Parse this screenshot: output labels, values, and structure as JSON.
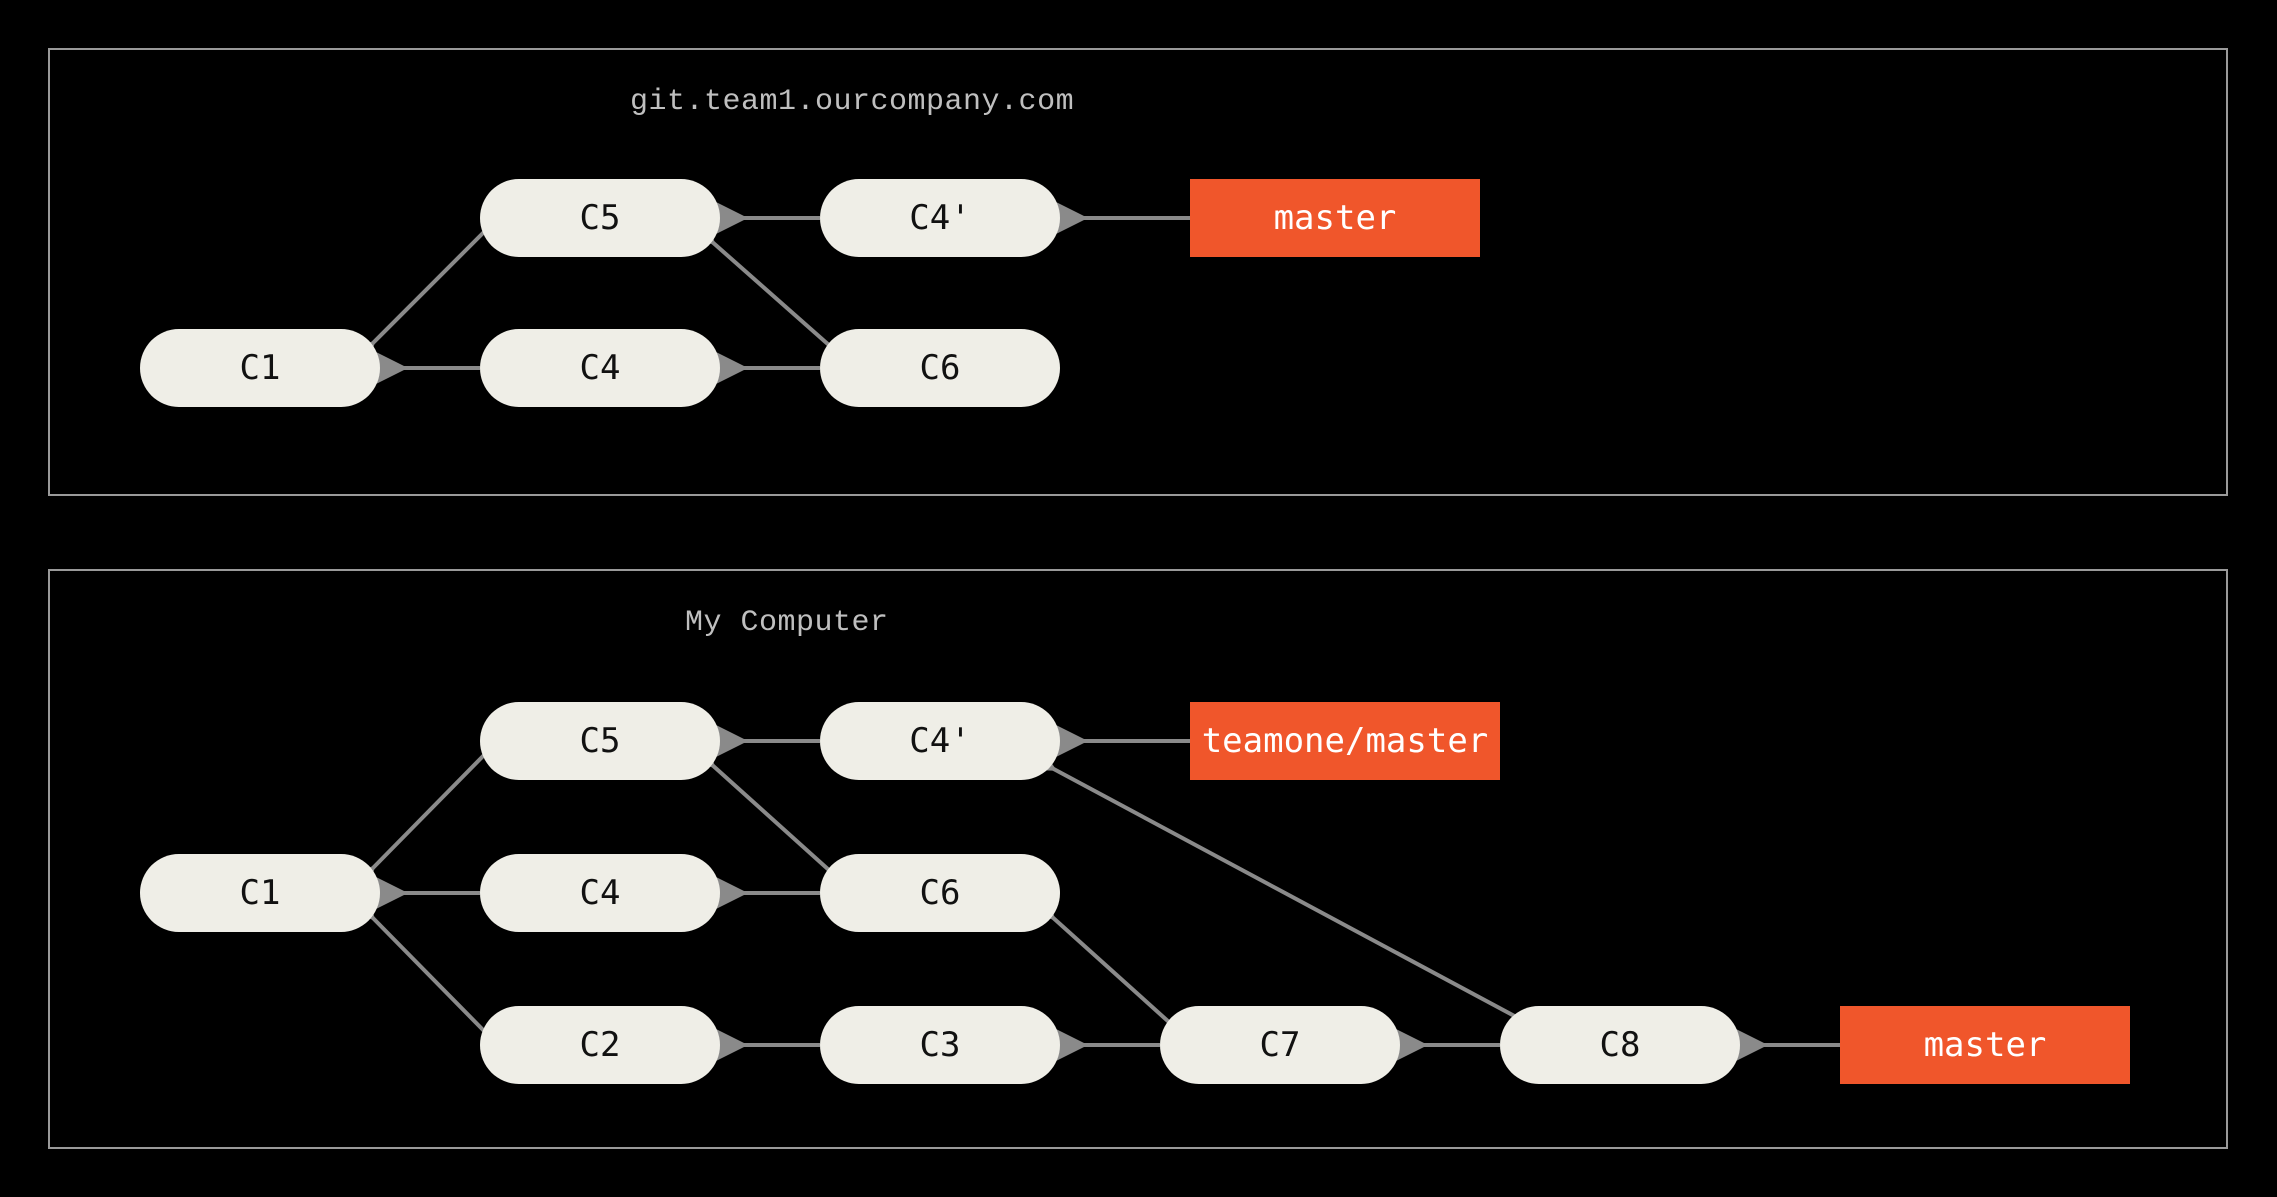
{
  "colors": {
    "bg": "#000000",
    "panel_border": "#9a9a9a",
    "commit_bg": "#efeee7",
    "commit_fg": "#111111",
    "ref_bg": "#f0562b",
    "ref_fg": "#ffffff",
    "arrow": "#8a8a8a",
    "title": "#bfbfbf"
  },
  "panels": {
    "server": {
      "title": "git.team1.ourcompany.com",
      "commits": {
        "c1": "C1",
        "c4": "C4",
        "c5": "C5",
        "c6": "C6",
        "c4p": "C4'"
      },
      "refs": {
        "master": "master"
      },
      "edges": [
        [
          "c5",
          "c1"
        ],
        [
          "c4",
          "c1"
        ],
        [
          "c6",
          "c4"
        ],
        [
          "c6",
          "c5"
        ],
        [
          "c4p",
          "c5"
        ],
        [
          "master",
          "c4p"
        ]
      ]
    },
    "local": {
      "title": "My Computer",
      "commits": {
        "c1": "C1",
        "c2": "C2",
        "c3": "C3",
        "c4": "C4",
        "c5": "C5",
        "c6": "C6",
        "c7": "C7",
        "c8": "C8",
        "c4p": "C4'"
      },
      "refs": {
        "teamone_master": "teamone/master",
        "master": "master"
      },
      "edges": [
        [
          "c5",
          "c1"
        ],
        [
          "c4",
          "c1"
        ],
        [
          "c2",
          "c1"
        ],
        [
          "c6",
          "c4"
        ],
        [
          "c3",
          "c2"
        ],
        [
          "c6",
          "c5"
        ],
        [
          "c4p",
          "c5"
        ],
        [
          "c7",
          "c3"
        ],
        [
          "c7",
          "c6"
        ],
        [
          "c8",
          "c7"
        ],
        [
          "c8",
          "c4p"
        ],
        [
          "teamone_master",
          "c4p"
        ],
        [
          "master",
          "c8"
        ]
      ]
    }
  }
}
